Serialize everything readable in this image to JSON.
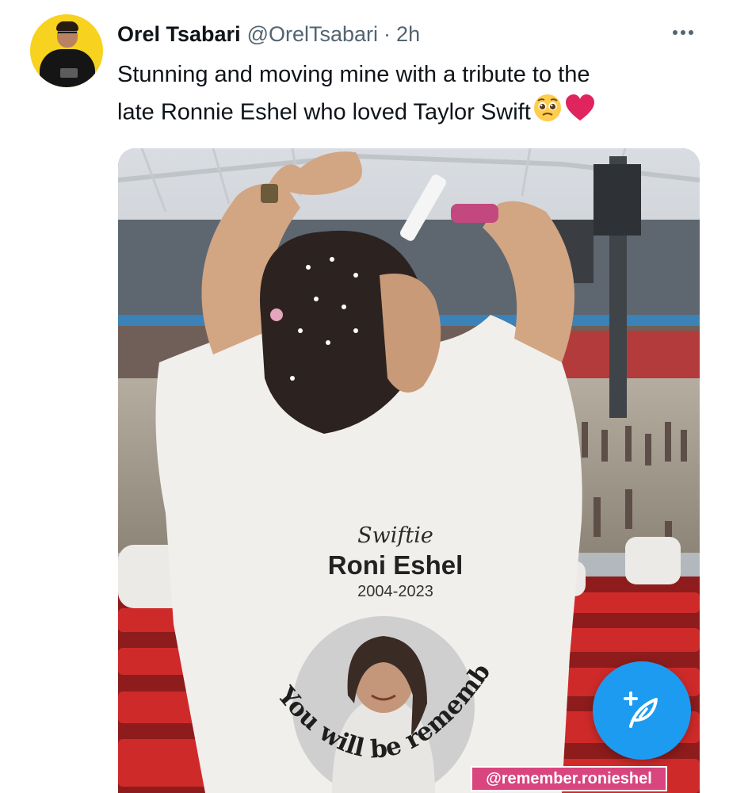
{
  "tweet": {
    "author": {
      "display_name": "Orel Tsabari",
      "handle": "@OrelTsabari",
      "separator": "·",
      "time": "2h"
    },
    "text_line1": "Stunning and moving mine with a tribute to the",
    "text_line2": "late Ronnie Eshel who loved Taylor Swift",
    "emojis": [
      "pleading-face-emoji",
      "red-heart-emoji"
    ]
  },
  "media": {
    "shirt": {
      "script_line": "Swiftie",
      "name": "Roni Eshel",
      "years": "2004-2023",
      "arc_text": "You will be remembered"
    },
    "watermark": "@remember.ronieshel"
  },
  "colors": {
    "accent": "#1d9bf0",
    "secondary_text": "#536471",
    "watermark_bg": "#d9457f",
    "heart": "#e0245e"
  },
  "icons": {
    "more": "more-options-icon",
    "compose": "compose-tweet-icon"
  }
}
